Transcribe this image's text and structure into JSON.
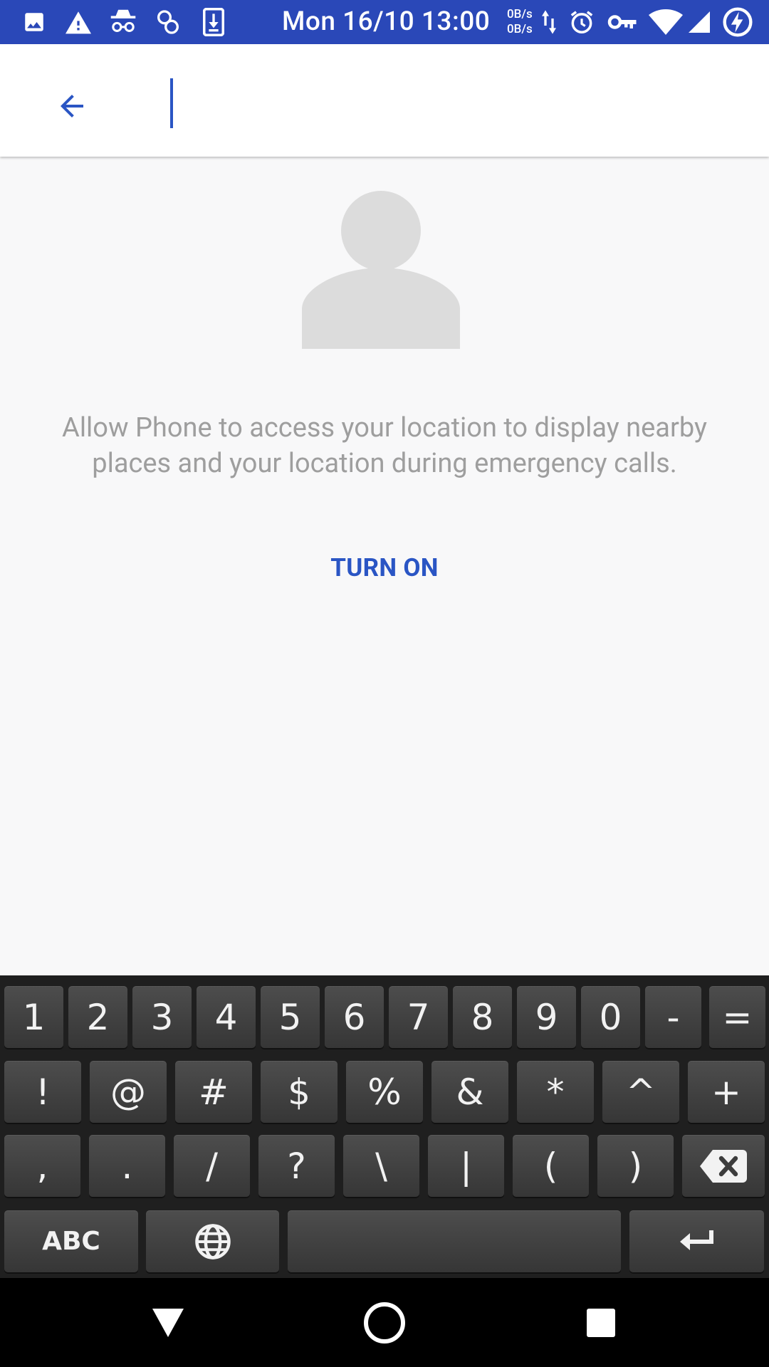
{
  "status_bar": {
    "time": "Mon 16/10 13:00",
    "speed_up": "0B/s",
    "speed_down": "0B/s",
    "icons": [
      "image-icon",
      "warning-icon",
      "incognito-icon",
      "link-icon",
      "download-icon",
      "data-arrows-icon",
      "alarm-icon",
      "key-icon",
      "wifi-icon",
      "signal-icon",
      "battery-charging-icon"
    ]
  },
  "search": {
    "value": "",
    "back_icon": "arrow-back-icon"
  },
  "location_prompt": {
    "message": "Allow Phone to access your location to display nearby places and your location during emergency calls.",
    "action_label": "TURN ON"
  },
  "keyboard": {
    "row1": [
      "1",
      "2",
      "3",
      "4",
      "5",
      "6",
      "7",
      "8",
      "9",
      "0",
      "-",
      "="
    ],
    "row2": [
      "!",
      "@",
      "#",
      "$",
      "%",
      "&",
      "*",
      "^",
      "+"
    ],
    "row3": [
      ",",
      ".",
      "/",
      "?",
      "\\",
      "|",
      "(",
      ")"
    ],
    "abc_label": "ABC"
  },
  "colors": {
    "accent": "#2a55c4",
    "status_bar": "#2a48b8",
    "background": "#f8f8f9"
  }
}
